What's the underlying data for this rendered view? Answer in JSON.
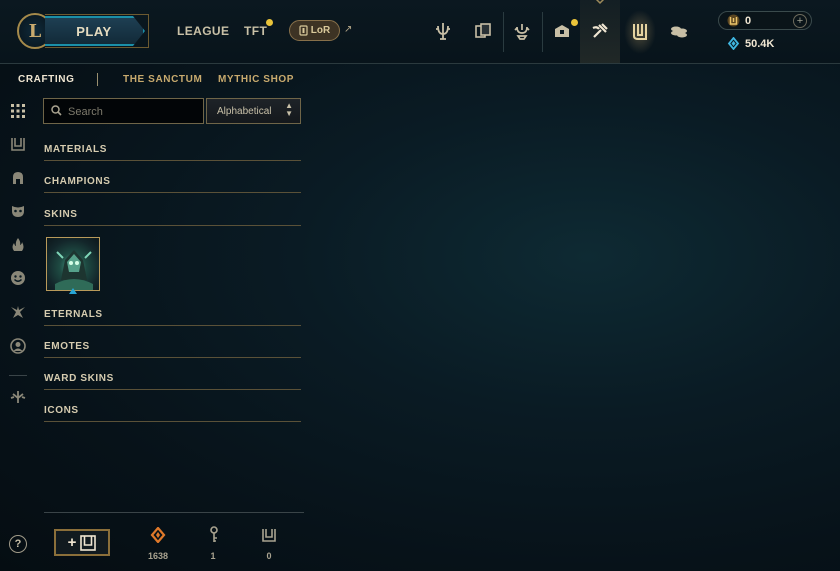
{
  "topbar": {
    "play_label": "PLAY",
    "nav": [
      {
        "label": "LEAGUE"
      },
      {
        "label": "TFT"
      }
    ],
    "lor_label": "LoR",
    "ext_arrow": "↗",
    "icons": [
      "tft-icon",
      "collection-cards-icon",
      "clash-trophy-icon",
      "loot-chest-icon",
      "crafting-hammer-icon",
      "hextech-icon",
      "store-coins-icon"
    ],
    "currency": {
      "rp_value": "0",
      "be_value": "50.4K",
      "add_symbol": "+"
    },
    "notify_color": "#e9c33a"
  },
  "subnav": {
    "tabs": [
      {
        "label": "CRAFTING",
        "active": true
      },
      {
        "label": "THE SANCTUM",
        "active": false
      },
      {
        "label": "MYTHIC SHOP",
        "active": false
      }
    ]
  },
  "rail": {
    "icons": [
      "grid-all-icon",
      "chest-icon",
      "helmet-icon",
      "mask-icon",
      "flame-icon",
      "emote-face-icon",
      "ward-icon",
      "profile-icon",
      "key-fragment-icon"
    ]
  },
  "filters": {
    "search_placeholder": "Search",
    "search_value": "",
    "sort_value": "Alphabetical",
    "sort_caret": "⌃⌄"
  },
  "categories": [
    {
      "label": "MATERIALS"
    },
    {
      "label": "CHAMPIONS"
    },
    {
      "label": "SKINS"
    },
    {
      "label": "ETERNALS"
    },
    {
      "label": "EMOTES"
    },
    {
      "label": "WARD SKINS"
    },
    {
      "label": "ICONS"
    }
  ],
  "bottombar": {
    "help_label": "?",
    "open_label": "+",
    "stats": [
      {
        "icon": "orange-essence-icon",
        "value": "1638"
      },
      {
        "icon": "key-icon",
        "value": "1"
      },
      {
        "icon": "chest-icon",
        "value": "0"
      }
    ]
  },
  "colors": {
    "gold": "#c8aa6e",
    "accent_blue": "#1b8fa8",
    "text": "#cdbe91"
  }
}
